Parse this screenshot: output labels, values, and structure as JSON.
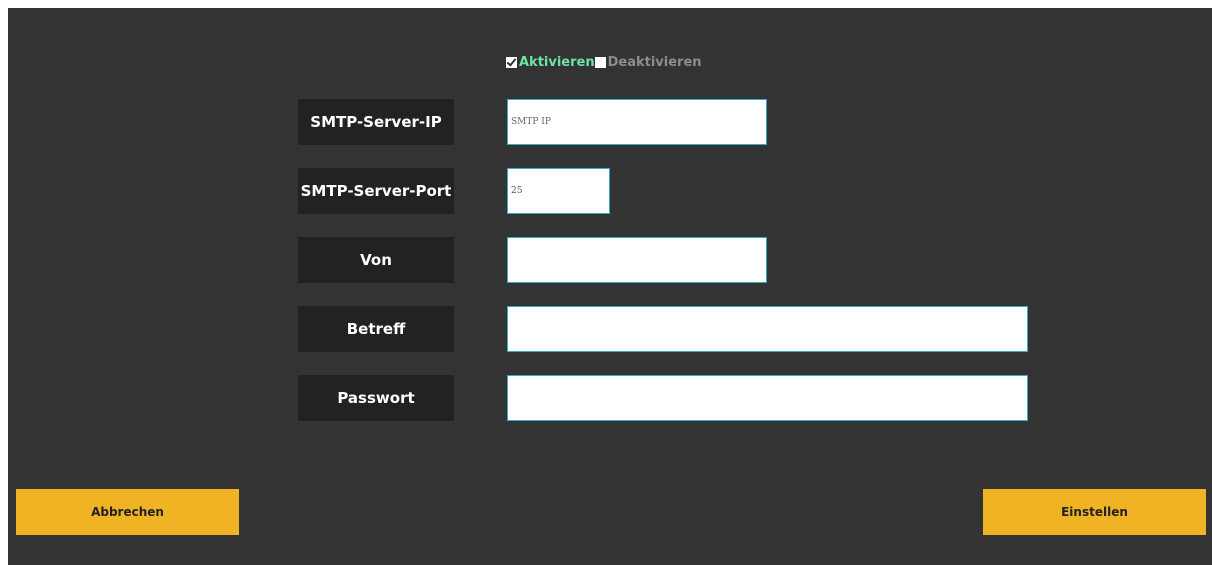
{
  "mode": {
    "enable_label": "Aktivieren",
    "disable_label": "Deaktivieren",
    "enabled": true
  },
  "fields": [
    {
      "label": "SMTP-Server-IP",
      "value": "",
      "placeholder": "SMTP IP"
    },
    {
      "label": "SMTP-Server-Port",
      "value": "25",
      "placeholder": ""
    },
    {
      "label": "Von",
      "value": "",
      "placeholder": ""
    },
    {
      "label": "Betreff",
      "value": "",
      "placeholder": ""
    },
    {
      "label": "Passwort",
      "value": "",
      "placeholder": ""
    }
  ],
  "buttons": {
    "cancel_label": "Abbrechen",
    "set_label": "Einstellen"
  },
  "colors": {
    "background": "#333333",
    "label_box": "#222222",
    "accent_button": "#f0b323",
    "active_option": "#6fe3a4",
    "inactive_option": "#8d8d8d",
    "field_border": "#37a8c9"
  }
}
